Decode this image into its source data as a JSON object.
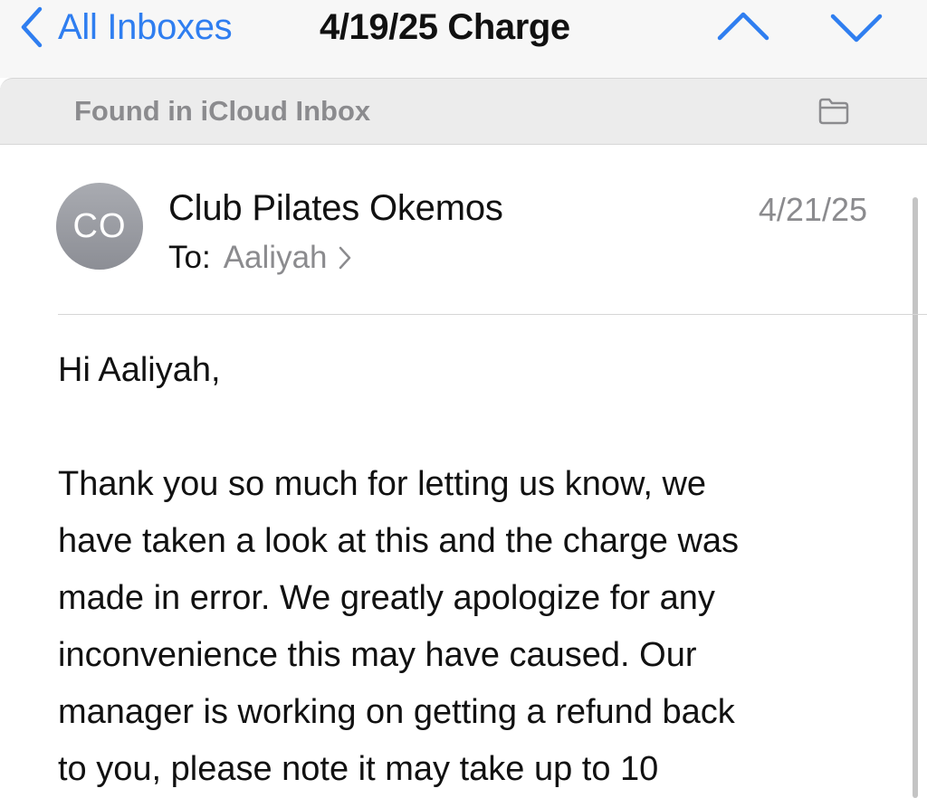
{
  "nav": {
    "back_label": "All Inboxes",
    "title": "4/19/25 Charge",
    "icons": {
      "back": "chevron-left-icon",
      "previous": "chevron-up-icon",
      "next": "chevron-down-icon"
    }
  },
  "banner": {
    "text": "Found in iCloud Inbox",
    "icon": "folder-icon"
  },
  "message": {
    "avatar_initials": "CO",
    "sender": "Club Pilates Okemos",
    "date": "4/21/25",
    "to_label": "To:",
    "recipient": "Aaliyah",
    "greeting": "Hi Aaliyah,",
    "body_lines": [
      "Thank you so much for letting us know, we",
      "have taken a look at this and the charge was",
      "made in error. We greatly apologize for any",
      "inconvenience this may have caused. Our",
      "manager is working on getting a refund back",
      "to you, please note it may take up to 10"
    ]
  },
  "colors": {
    "accent": "#2f7ef0",
    "secondary_text": "#8b8b8e",
    "primary_text": "#111111",
    "avatar": "#9a9ca2"
  }
}
